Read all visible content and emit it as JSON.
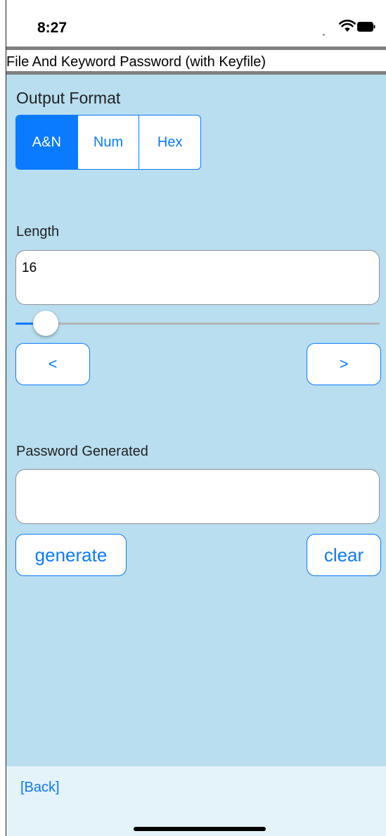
{
  "status_bar": {
    "time": "8:27",
    "icons": [
      "signal-dots-icon",
      "wifi-icon",
      "battery-icon"
    ]
  },
  "title_bar": {
    "title": "File And Keyword Password (with Keyfile)"
  },
  "output_format": {
    "label": "Output Format",
    "options": [
      "A&N",
      "Num",
      "Hex"
    ],
    "selected": "A&N"
  },
  "length": {
    "label": "Length",
    "value": "16",
    "slider_fraction": 0.08,
    "prev_label": "<",
    "next_label": ">"
  },
  "password": {
    "label": "Password Generated",
    "value": "",
    "generate_label": "generate",
    "clear_label": "clear"
  },
  "footer": {
    "back_label": "[Back]"
  },
  "colors": {
    "accent": "#0a7aff",
    "background": "#b8def0",
    "footer_background": "#e4f2f9",
    "divider": "#808080"
  }
}
